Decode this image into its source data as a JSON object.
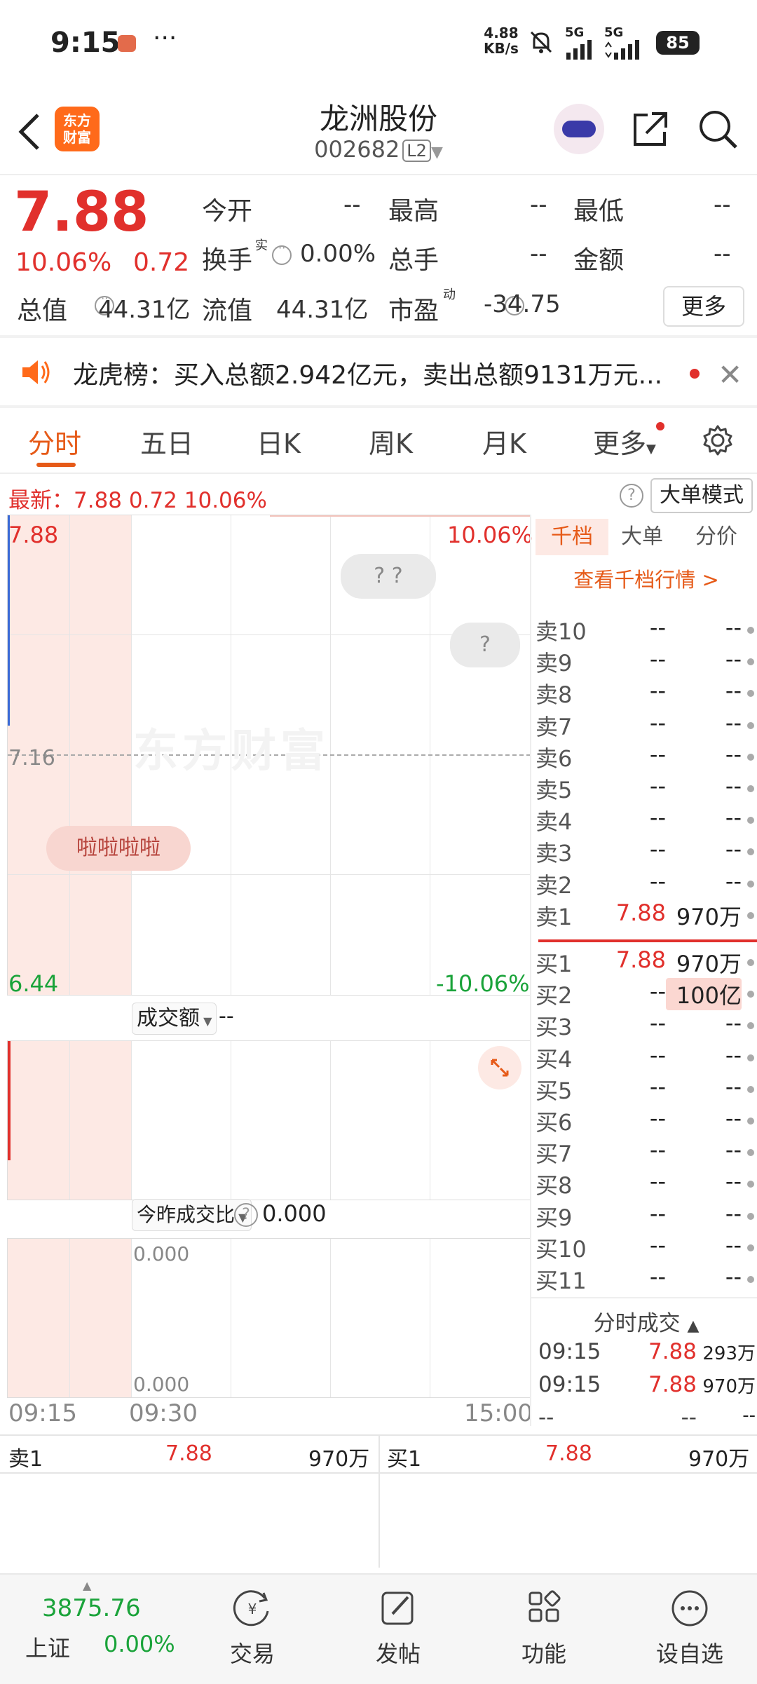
{
  "status_bar": {
    "time": "9:15",
    "dots": "···",
    "speed_top": "4.88",
    "speed_bottom": "KB/s",
    "signal1": "5G",
    "signal2": "5G",
    "battery": "85"
  },
  "header": {
    "logo_line1": "东方",
    "logo_line2": "财富",
    "title": "龙洲股份",
    "code": "002682",
    "level": "L2"
  },
  "quote": {
    "price": "7.88",
    "change_pct": "10.06%",
    "change": "0.72",
    "open_label": "今开",
    "open_value": "--",
    "high_label": "最高",
    "high_value": "--",
    "low_label": "最低",
    "low_value": "--",
    "turnover_label": "换手",
    "turnover_sup": "实",
    "turnover_value": "0.00%",
    "volume_label": "总手",
    "volume_value": "--",
    "amount_label": "金额",
    "amount_value": "--",
    "mcap_label": "总值",
    "mcap_value": "44.31亿",
    "float_label": "流值",
    "float_value": "44.31亿",
    "pe_label": "市盈",
    "pe_sup": "动",
    "pe_value": "-34.75",
    "more_button": "更多"
  },
  "notice": {
    "text": "龙虎榜：买入总额2.942亿元，卖出总额9131万元..."
  },
  "tabs": [
    "分时",
    "五日",
    "日K",
    "周K",
    "月K",
    "更多"
  ],
  "latest_bar": {
    "text": "最新：7.88  0.72  10.06%",
    "big_order_mode": "大单模式"
  },
  "chart": {
    "top_price": "7.88",
    "top_pct": "10.06%",
    "mid_price": "7.16",
    "bottom_price": "6.44",
    "bottom_pct": "-10.06%",
    "bubble1": "? ?",
    "bubble2": "?",
    "bubble3": "啦啦啦啦",
    "watermark": "东方财富",
    "amount_selector": "成交额",
    "amount_value": "--",
    "ratio_selector": "今昨成交比",
    "ratio_value": "0.000",
    "ratio_top": "0.000",
    "ratio_bottom": "0.000",
    "time_start": "09:15",
    "time_mid": "09:30",
    "time_end": "15:00",
    "colors": {
      "up": "#e1302c",
      "down": "#1aa33a",
      "shade": "#fde9e4"
    }
  },
  "order_book": {
    "tabs": [
      "千档",
      "大单",
      "分价"
    ],
    "link": "查看千档行情 >",
    "sell": [
      {
        "label": "卖10",
        "price": "--",
        "volume": "--"
      },
      {
        "label": "卖9",
        "price": "--",
        "volume": "--"
      },
      {
        "label": "卖8",
        "price": "--",
        "volume": "--"
      },
      {
        "label": "卖7",
        "price": "--",
        "volume": "--"
      },
      {
        "label": "卖6",
        "price": "--",
        "volume": "--"
      },
      {
        "label": "卖5",
        "price": "--",
        "volume": "--"
      },
      {
        "label": "卖4",
        "price": "--",
        "volume": "--"
      },
      {
        "label": "卖3",
        "price": "--",
        "volume": "--"
      },
      {
        "label": "卖2",
        "price": "--",
        "volume": "--"
      },
      {
        "label": "卖1",
        "price": "7.88",
        "volume": "970万"
      }
    ],
    "buy": [
      {
        "label": "买1",
        "price": "7.88",
        "volume": "970万"
      },
      {
        "label": "买2",
        "price": "--",
        "volume": "100亿"
      },
      {
        "label": "买3",
        "price": "--",
        "volume": "--"
      },
      {
        "label": "买4",
        "price": "--",
        "volume": "--"
      },
      {
        "label": "买5",
        "price": "--",
        "volume": "--"
      },
      {
        "label": "买6",
        "price": "--",
        "volume": "--"
      },
      {
        "label": "买7",
        "price": "--",
        "volume": "--"
      },
      {
        "label": "买8",
        "price": "--",
        "volume": "--"
      },
      {
        "label": "买9",
        "price": "--",
        "volume": "--"
      },
      {
        "label": "买10",
        "price": "--",
        "volume": "--"
      },
      {
        "label": "买11",
        "price": "--",
        "volume": "--"
      }
    ],
    "trades_title": "分时成交",
    "trades": [
      {
        "time": "09:15",
        "price": "7.88",
        "volume": "293万"
      },
      {
        "time": "09:15",
        "price": "7.88",
        "volume": "970万"
      },
      {
        "time": "--",
        "price": "--",
        "volume": "--"
      }
    ]
  },
  "bottom_compare": {
    "left_label": "卖1",
    "left_price": "7.88",
    "left_volume": "970万",
    "right_label": "买1",
    "right_price": "7.88",
    "right_volume": "970万"
  },
  "bottom_nav": {
    "index_value": "3875.76",
    "index_name": "上证",
    "index_change": "0.00%",
    "items": [
      "交易",
      "发帖",
      "功能",
      "设自选"
    ]
  }
}
